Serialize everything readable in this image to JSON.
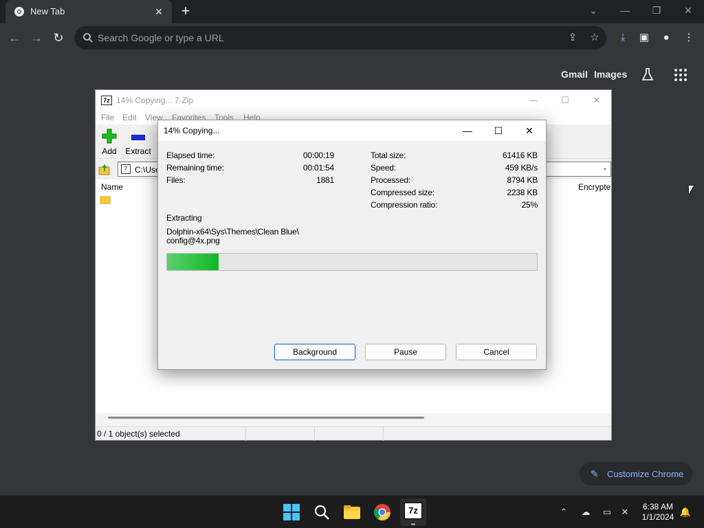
{
  "browser": {
    "tab_title": "New Tab",
    "omnibox_placeholder": "Search Google or type a URL",
    "ntp": {
      "gmail": "Gmail",
      "images": "Images"
    },
    "customize_label": "Customize Chrome"
  },
  "zip_window": {
    "title": "14% Copying... 7-Zip",
    "menu": [
      "File",
      "Edit",
      "View",
      "Favorites",
      "Tools",
      "Help"
    ],
    "toolbar": {
      "add": "Add",
      "extract": "Extract"
    },
    "address": "C:\\Use",
    "columns": {
      "name": "Name",
      "encrypted": "Encrypte"
    },
    "status": "0 / 1 object(s) selected"
  },
  "dialog": {
    "title": "14% Copying...",
    "left": [
      {
        "label": "Elapsed time:",
        "value": "00:00:19"
      },
      {
        "label": "Remaining time:",
        "value": "00:01:54"
      },
      {
        "label": "Files:",
        "value": "1881"
      }
    ],
    "right": [
      {
        "label": "Total size:",
        "value": "61416 KB"
      },
      {
        "label": "Speed:",
        "value": "459 KB/s"
      },
      {
        "label": "Processed:",
        "value": "8794 KB"
      },
      {
        "label": "Compressed size:",
        "value": "2238 KB"
      },
      {
        "label": "Compression ratio:",
        "value": "25%"
      }
    ],
    "operation": "Extracting",
    "path_line1": "Dolphin-x64\\Sys\\Themes\\Clean Blue\\",
    "path_line2": "config@4x.png",
    "progress_fraction": 0.14,
    "buttons": {
      "background": "Background",
      "pause": "Pause",
      "cancel": "Cancel"
    }
  },
  "taskbar": {
    "time": "6:38 AM",
    "date": "1/1/2024",
    "icons": [
      "windows-start-icon",
      "search-icon",
      "file-explorer-icon",
      "chrome-icon",
      "7zip-icon"
    ]
  },
  "colors": {
    "accent": "#0067c0",
    "progress": "#0fb626",
    "chrome_link": "#8ab4f8"
  }
}
